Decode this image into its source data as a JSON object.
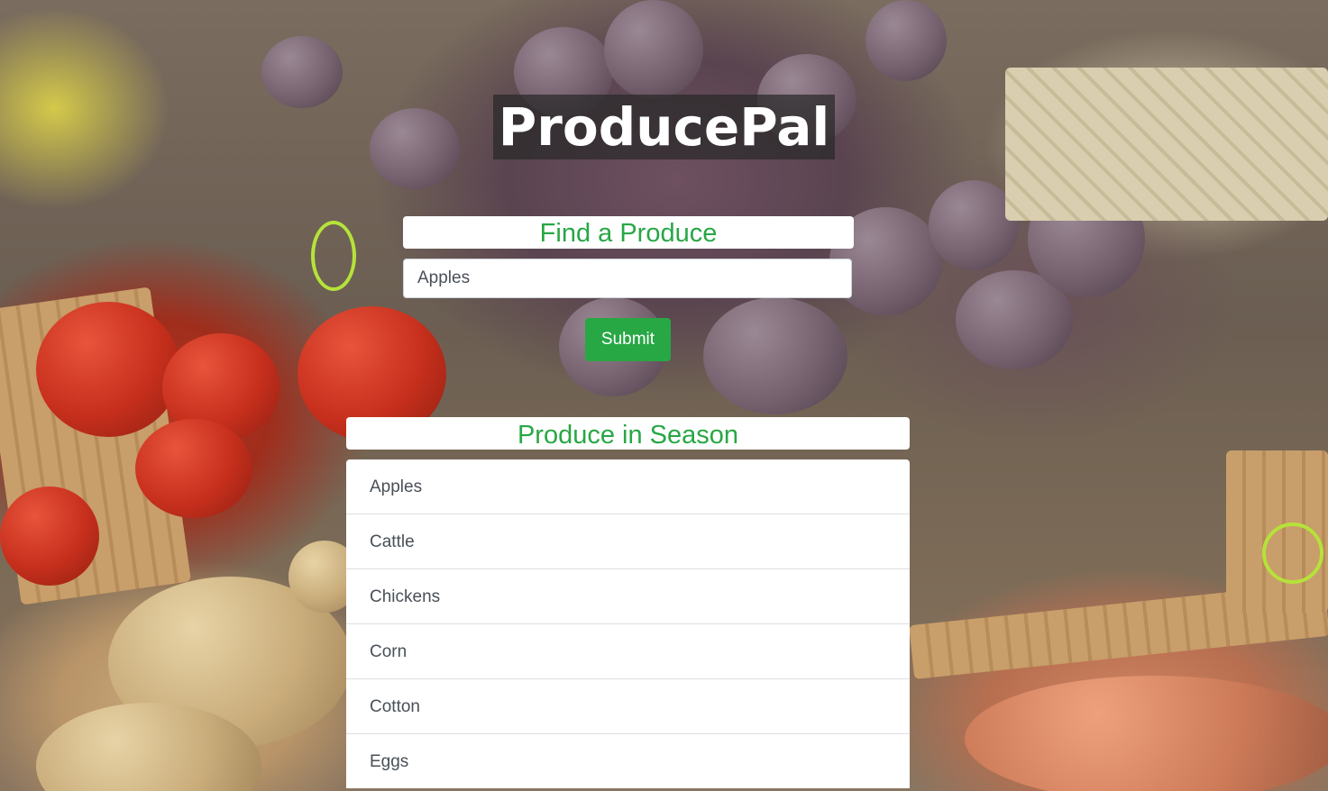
{
  "app": {
    "title": "ProducePal"
  },
  "search": {
    "heading": "Find a Produce",
    "value": "Apples",
    "submit_label": "Submit"
  },
  "season": {
    "heading": "Produce in Season",
    "items": [
      "Apples",
      "Cattle",
      "Chickens",
      "Corn",
      "Cotton",
      "Eggs"
    ]
  },
  "colors": {
    "accent": "#28a745",
    "title_bg": "#282828"
  }
}
